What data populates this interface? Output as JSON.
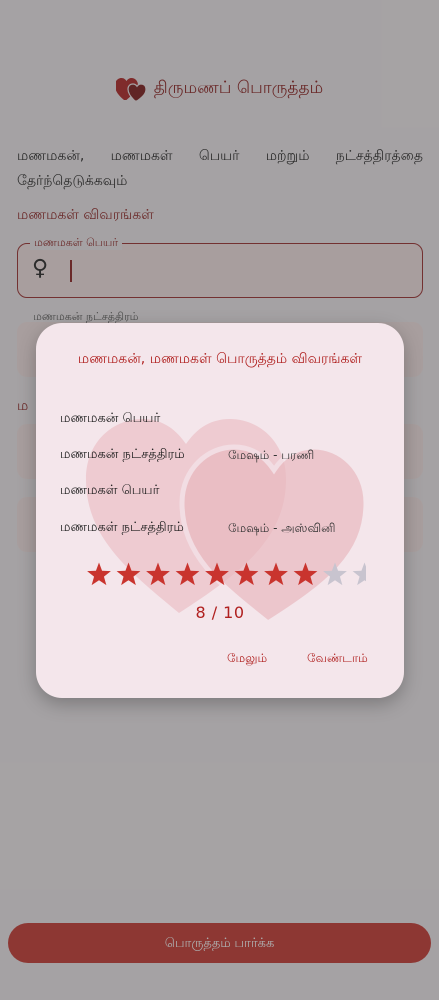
{
  "app": {
    "title": "திருமணப் பொருத்தம்"
  },
  "form": {
    "instruction": "மணமகன், மணமகள் பெயர் மற்றும் நட்சத்திரத்தை தேர்ந்தெடுக்கவும்",
    "bride_section_title": "மணமகள் விவரங்கள்",
    "bride_name_label": "மணமகள் பெயர்",
    "bride_name_value": "",
    "groom_star_label": "மணமகன் நட்சத்திரம்",
    "submit_label": "பொருத்தம் பார்க்க"
  },
  "dialog": {
    "title": "மணமகன், மணமகள் பொருத்தம் விவரங்கள்",
    "rows": [
      {
        "label": "மணமகன் பெயர்",
        "value": ""
      },
      {
        "label": "மணமகன் நட்சத்திரம்",
        "value": "மேஷம் - பரணி"
      },
      {
        "label": "மணமகள் பெயர்",
        "value": ""
      },
      {
        "label": "மணமகள் நட்சத்திரம்",
        "value": "மேஷம் - அஸ்வினி"
      }
    ],
    "rating": {
      "score": 8,
      "max": 10,
      "display": "8 / 10"
    },
    "more_label": "மேலும்",
    "dismiss_label": "வேண்டாம்"
  },
  "colors": {
    "accent": "#b0201f",
    "primary_dark": "#8c1c1c",
    "star_filled": "#c9342e",
    "star_empty": "#c8c4cf",
    "dialog_bg": "#f4e6eb",
    "field_bg": "#f7e6e6"
  },
  "icons": {
    "logo": "two-hearts-icon",
    "bride_field": "female-symbol-icon",
    "rating": "star-icon"
  }
}
